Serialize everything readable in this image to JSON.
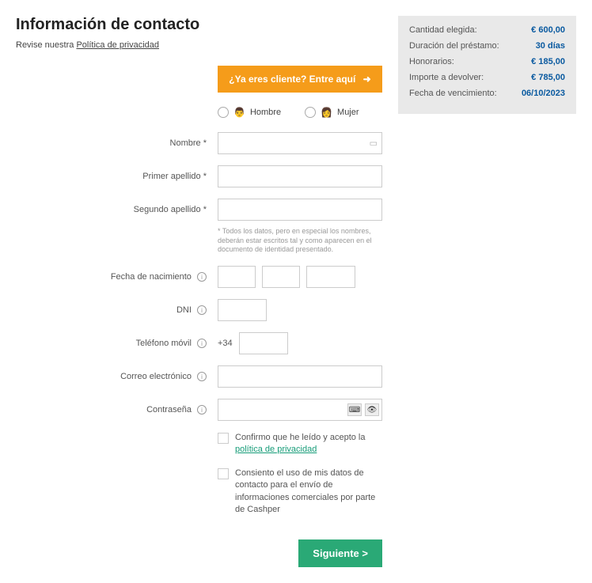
{
  "header": {
    "title": "Información de contacto",
    "privacy_prefix": "Revise nuestra ",
    "privacy_link": "Política de privacidad"
  },
  "login_banner": {
    "text": "¿Ya eres cliente? Entre aquí",
    "arrow": "➜"
  },
  "gender": {
    "male": "Hombre",
    "female": "Mujer"
  },
  "fields": {
    "name_label": "Nombre *",
    "surname1_label": "Primer apellido *",
    "surname2_label": "Segundo apellido *",
    "names_note": "* Todos los datos, pero en especial los nombres, deberán estar escritos tal y como aparecen en el documento de identidad presentado.",
    "dob_label": "Fecha de nacimiento",
    "dni_label": "DNI",
    "phone_label": "Teléfono móvil",
    "phone_prefix": "+34",
    "email_label": "Correo electrónico",
    "password_label": "Contraseña"
  },
  "checkboxes": {
    "privacy_text_pre": "Confirmo que he leído y acepto la ",
    "privacy_link": "política de privacidad",
    "marketing_text": "Consiento el uso de mis datos de contacto para el envío de informaciones comerciales por parte de Cashper"
  },
  "submit": {
    "label": "Siguiente >"
  },
  "summary": {
    "amount_label": "Cantidad elegida:",
    "amount_value": "€  600,00",
    "duration_label": "Duración del préstamo:",
    "duration_value": "30 días",
    "fees_label": "Honorarios:",
    "fees_value": "€  185,00",
    "total_label": "Importe a devolver:",
    "total_value": "€  785,00",
    "due_label": "Fecha de vencimiento:",
    "due_value": "06/10/2023"
  }
}
